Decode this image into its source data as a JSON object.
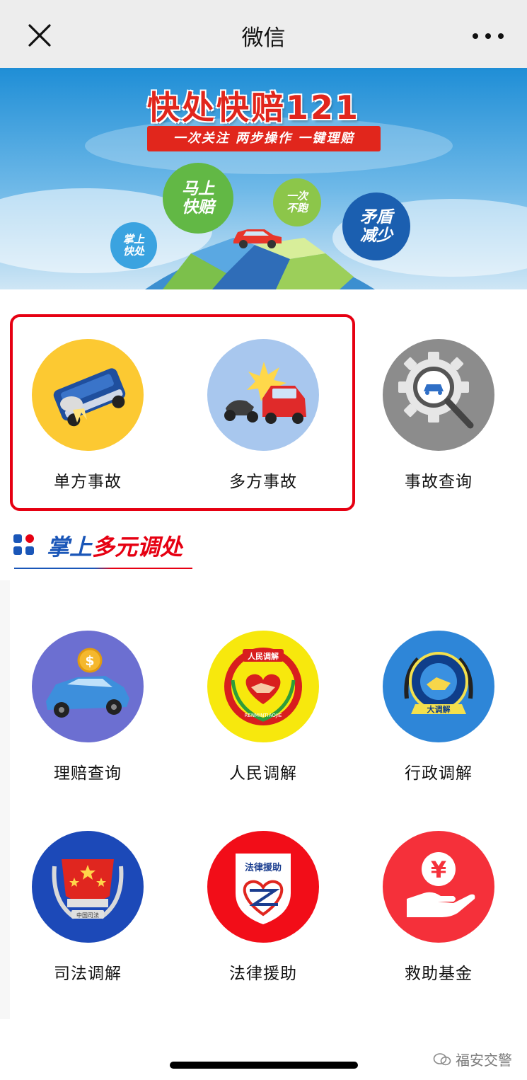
{
  "navbar": {
    "title": "微信"
  },
  "banner": {
    "title": "快处快赔121",
    "slogan": "一次关注 两步操作 一键理赔",
    "bubbles": {
      "b1": "掌上\n快处",
      "b2": "马上\n快赔",
      "b3": "一次\n不跑",
      "b4": "矛盾\n减少"
    }
  },
  "top_row": [
    {
      "label": "单方事故"
    },
    {
      "label": "多方事故"
    },
    {
      "label": "事故查询"
    }
  ],
  "section": {
    "title_blue": "掌上",
    "title_red": "多元调处"
  },
  "grid_row1": [
    {
      "label": "理赔查询"
    },
    {
      "label": "人民调解"
    },
    {
      "label": "行政调解"
    }
  ],
  "grid_row2": [
    {
      "label": "司法调解"
    },
    {
      "label": "法律援助"
    },
    {
      "label": "救助基金"
    }
  ],
  "badges": {
    "people": "人民调解",
    "people_en": "RENMINTIAOJIE",
    "admin": "大调解",
    "judicial": "中国司法",
    "legal": "法律援助",
    "fund": "¥"
  },
  "watermark": "福安交警",
  "colors": {
    "accent_red": "#e60012",
    "brand_blue": "#1a56b8",
    "single_accident_bg": "#fcc932",
    "multi_accident_bg": "#a8c7ee",
    "query_bg": "#8c8c8c",
    "claim_bg": "#6c6fd1",
    "people_bg": "#f7e80d",
    "admin_bg": "#2e86d8",
    "judicial_bg": "#1c49b8",
    "legal_bg": "#f20d18",
    "fund_bg": "#f5303a"
  },
  "icons": {
    "close": "close-icon",
    "more": "more-icon",
    "single": "overturned-car-icon",
    "multi": "collision-icon",
    "query": "gear-search-icon",
    "claim": "car-coin-icon",
    "people": "handshake-heart-badge-icon",
    "admin": "handshake-badge-icon",
    "judicial": "justice-emblem-icon",
    "legal": "legal-aid-shield-icon",
    "fund": "yuan-hand-icon"
  }
}
